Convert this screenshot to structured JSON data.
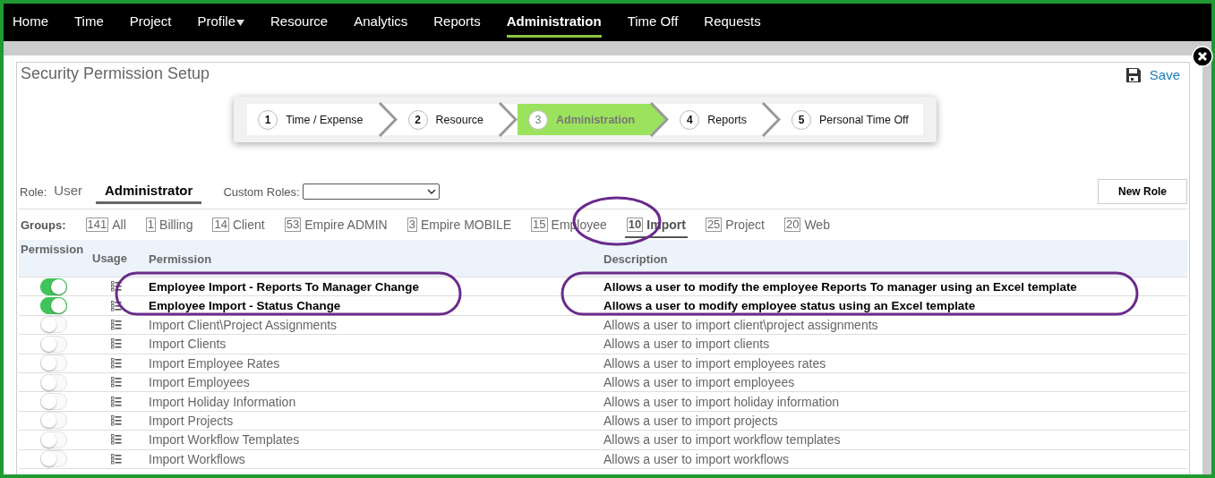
{
  "nav": [
    {
      "label": "Home",
      "selected": false,
      "has_menu": false
    },
    {
      "label": "Time",
      "selected": false,
      "has_menu": false
    },
    {
      "label": "Project",
      "selected": false,
      "has_menu": false
    },
    {
      "label": "Profile",
      "selected": false,
      "has_menu": true
    },
    {
      "label": "Resource",
      "selected": false,
      "has_menu": false
    },
    {
      "label": "Analytics",
      "selected": false,
      "has_menu": false
    },
    {
      "label": "Reports",
      "selected": false,
      "has_menu": false
    },
    {
      "label": "Administration",
      "selected": true,
      "has_menu": false
    },
    {
      "label": "Time Off",
      "selected": false,
      "has_menu": false
    },
    {
      "label": "Requests",
      "selected": false,
      "has_menu": false
    }
  ],
  "title": "Security Permission Setup",
  "save": "Save",
  "steps": [
    {
      "number": "1",
      "label": "Time / Expense",
      "selected": false
    },
    {
      "number": "2",
      "label": "Resource",
      "selected": false
    },
    {
      "number": "3",
      "label": "Administration",
      "selected": true
    },
    {
      "number": "4",
      "label": "Reports",
      "selected": false
    },
    {
      "number": "5",
      "label": "Personal Time Off",
      "selected": false
    }
  ],
  "role": {
    "label": "Role:",
    "options": [
      {
        "label": "User",
        "selected": false
      },
      {
        "label": "Administrator",
        "selected": true
      }
    ],
    "custom_label": "Custom Roles:"
  },
  "new_role": "New Role",
  "groups": {
    "label": "Groups:",
    "items": [
      {
        "count": "141",
        "label": "All",
        "selected": false
      },
      {
        "count": "1",
        "label": "Billing",
        "selected": false
      },
      {
        "count": "14",
        "label": "Client",
        "selected": false
      },
      {
        "count": "53",
        "label": "Empire ADMIN",
        "selected": false
      },
      {
        "count": "3",
        "label": "Empire MOBILE",
        "selected": false
      },
      {
        "count": "15",
        "label": "Employee",
        "selected": false
      },
      {
        "count": "10",
        "label": "Import",
        "selected": true
      },
      {
        "count": "25",
        "label": "Project",
        "selected": false
      },
      {
        "count": "20",
        "label": "Web",
        "selected": false
      }
    ]
  },
  "table": {
    "columns": [
      "Permission",
      "Usage",
      "Permission",
      "Description"
    ],
    "rows": [
      {
        "permission": "Employee Import - Reports To Manager Change",
        "description": "Allows a user to modify the employee Reports To manager using an Excel template",
        "on": true
      },
      {
        "permission": "Employee Import - Status Change",
        "description": "Allows a user to modify employee status using an Excel template",
        "on": true
      },
      {
        "permission": "Import Client\\Project Assignments",
        "description": "Allows a user to import client\\project assignments",
        "on": false
      },
      {
        "permission": "Import Clients",
        "description": "Allows a user to import clients",
        "on": false
      },
      {
        "permission": "Import Employee Rates",
        "description": "Allows a user to import employees rates",
        "on": false
      },
      {
        "permission": "Import Employees",
        "description": "Allows a user to import employees",
        "on": false
      },
      {
        "permission": "Import Holiday Information",
        "description": "Allows a user to import holiday information",
        "on": false
      },
      {
        "permission": "Import Projects",
        "description": "Allows a user to import projects",
        "on": false
      },
      {
        "permission": "Import Workflow Templates",
        "description": "Allows a user to import workflow templates",
        "on": false
      },
      {
        "permission": "Import Workflows",
        "description": "Allows a user to import workflows",
        "on": false
      }
    ]
  }
}
